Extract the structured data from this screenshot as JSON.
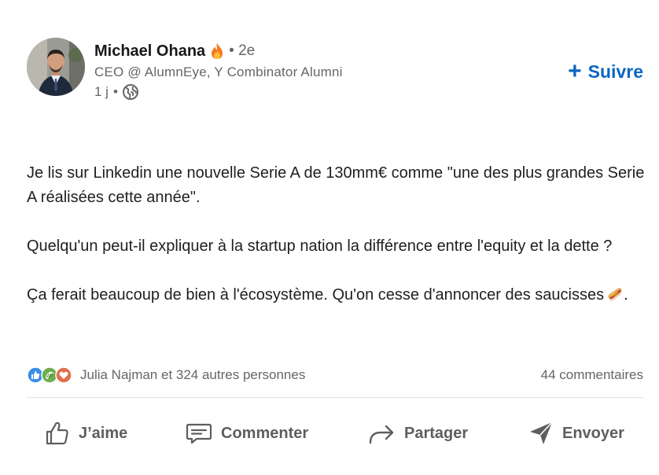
{
  "post": {
    "author": {
      "name": "Michael Ohana",
      "badge_icon": "fire-icon",
      "connection_degree": "• 2e",
      "headline": "CEO @ AlumnEye, Y Combinator Alumni",
      "time": "1 j",
      "meta_separator": "•",
      "visibility_icon": "globe-icon"
    },
    "follow_label": "Suivre",
    "body": {
      "paragraph_1": "Je lis sur Linkedin une nouvelle Serie A de 130mm€ comme \"une des plus grandes Serie A réalisées cette année\".",
      "paragraph_2": "Quelqu'un peut-il expliquer à la startup nation la différence entre l'equity et la dette ?",
      "paragraph_3": "Ça ferait beaucoup de bien à l'écosystème. Qu'on cesse d'annoncer des saucisses",
      "paragraph_3_end": ".",
      "emoji": "hotdog-icon"
    },
    "reactions": {
      "icons": [
        "like-icon",
        "celebrate-icon",
        "love-icon"
      ],
      "summary": "Julia Najman et 324 autres personnes",
      "comments": "44 commentaires"
    },
    "actions": {
      "like": "J’aime",
      "comment": "Commenter",
      "share": "Partager",
      "send": "Envoyer"
    },
    "colors": {
      "accent": "#0a66c2",
      "secondary_text": "#666666",
      "primary_text": "#1f1f1f"
    }
  }
}
